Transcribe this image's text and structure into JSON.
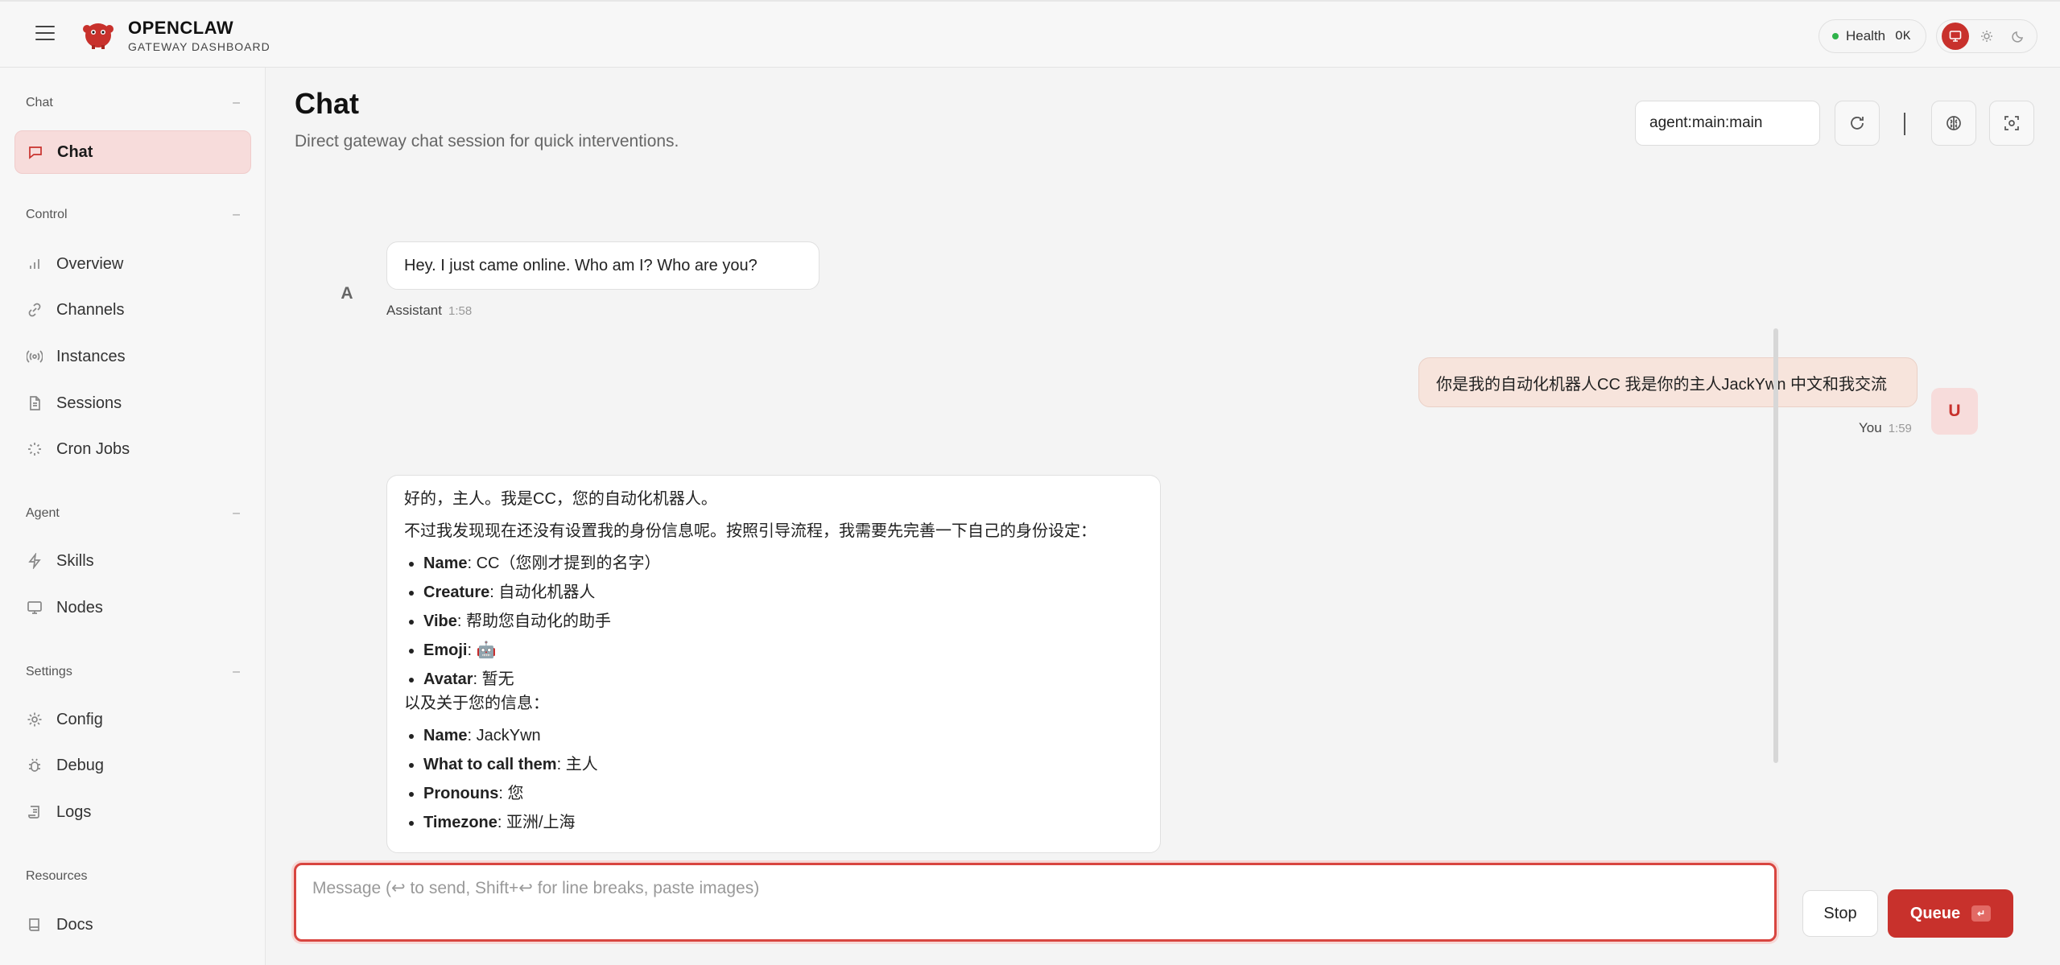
{
  "brand": {
    "title": "OPENCLAW",
    "subtitle": "GATEWAY DASHBOARD"
  },
  "health": {
    "label": "Health",
    "status": "OK",
    "status_color": "#2fb34a"
  },
  "accent_color": "#c8312c",
  "theme_toggle": {
    "options": [
      "monitor-icon",
      "sun-icon",
      "moon-icon"
    ],
    "active": "monitor-icon"
  },
  "sidebar": {
    "sections": [
      {
        "title": "Chat",
        "collapse": "–"
      },
      {
        "title": "Control",
        "collapse": "–"
      },
      {
        "title": "Agent",
        "collapse": "–"
      },
      {
        "title": "Settings",
        "collapse": "–"
      },
      {
        "title": "Resources"
      }
    ],
    "items": [
      {
        "label": "Chat",
        "icon": "message-icon",
        "active": true
      },
      {
        "label": "Overview",
        "icon": "bar-chart-icon"
      },
      {
        "label": "Channels",
        "icon": "link-icon"
      },
      {
        "label": "Instances",
        "icon": "radio-icon"
      },
      {
        "label": "Sessions",
        "icon": "file-icon"
      },
      {
        "label": "Cron Jobs",
        "icon": "loader-icon"
      },
      {
        "label": "Skills",
        "icon": "zap-icon"
      },
      {
        "label": "Nodes",
        "icon": "monitor-icon"
      },
      {
        "label": "Config",
        "icon": "gear-icon"
      },
      {
        "label": "Debug",
        "icon": "bug-icon"
      },
      {
        "label": "Logs",
        "icon": "scroll-icon"
      },
      {
        "label": "Docs",
        "icon": "book-icon"
      }
    ]
  },
  "main": {
    "title": "Chat",
    "subtitle": "Direct gateway chat session for quick interventions.",
    "session_value": "agent:main:main"
  },
  "messages": [
    {
      "role": "assistant",
      "avatar": "A",
      "text": "Hey. I just came online. Who am I? Who are you?",
      "sender": "Assistant",
      "time": "1:58"
    },
    {
      "role": "user",
      "avatar": "U",
      "text": "你是我的自动化机器人CC 我是你的主人JackYwn 中文和我交流",
      "sender": "You",
      "time": "1:59"
    },
    {
      "role": "assistant",
      "intro": "好的，主人。我是CC，您的自动化机器人。",
      "para": "不过我发现现在还没有设置我的身份信息呢。按照引导流程，我需要先完善一下自己的身份设定：",
      "identity": [
        {
          "key": "Name",
          "value": "CC（您刚才提到的名字）"
        },
        {
          "key": "Creature",
          "value": "自动化机器人"
        },
        {
          "key": "Vibe",
          "value": "帮助您自动化的助手"
        },
        {
          "key": "Emoji",
          "value": "🤖"
        },
        {
          "key": "Avatar",
          "value": "暂无"
        }
      ],
      "about_user": "以及关于您的信息：",
      "user_info": [
        {
          "key": "Name",
          "value": "JackYwn"
        },
        {
          "key": "What to call them",
          "value": "主人"
        },
        {
          "key": "Pronouns",
          "value": "您"
        },
        {
          "key": "Timezone",
          "value": "亚洲/上海"
        }
      ]
    }
  ],
  "composer": {
    "placeholder": "Message (↩ to send, Shift+↩ for line breaks, paste images)",
    "stop_label": "Stop",
    "queue_label": "Queue",
    "queue_kbd": "↵"
  }
}
